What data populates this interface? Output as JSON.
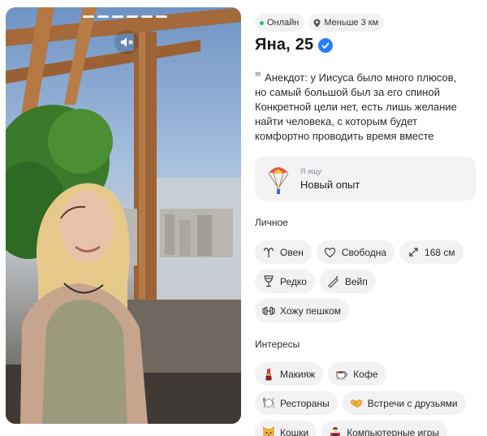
{
  "photo": {
    "progress_segments": 6,
    "mute_icon": "speaker-muted-icon"
  },
  "status": {
    "online_label": "Онлайн",
    "distance_label": "Меньше 3 км",
    "online_color": "#2cc44a"
  },
  "profile": {
    "name_age": "Яна, 25",
    "verified_color": "#2a7dff",
    "bio_lines": [
      "Анекдот: у Иисуса было много плюсов,",
      "но самый большой был за его спиной",
      "Конкретной цели нет, есть лишь желание",
      "найти человека, с которым будет",
      "комфортно проводить время вместе"
    ]
  },
  "seeking": {
    "label": "Я ищу",
    "value": "Новый опыт",
    "icon": "parachute-icon"
  },
  "personal": {
    "title": "Личное",
    "rows": [
      [
        {
          "icon": "aries-icon",
          "label": "Овен"
        },
        {
          "icon": "heart-icon",
          "label": "Свободна"
        },
        {
          "icon": "height-icon",
          "label": "168 см"
        }
      ],
      [
        {
          "icon": "wine-glass-icon",
          "label": "Редко"
        },
        {
          "icon": "vape-icon",
          "label": "Вейп"
        }
      ],
      [
        {
          "icon": "dumbbell-icon",
          "label": "Хожу пешком"
        }
      ]
    ]
  },
  "interests": {
    "title": "Интересы",
    "rows": [
      [
        {
          "icon": "lipstick-icon",
          "label": "Макияж"
        },
        {
          "icon": "coffee-icon",
          "label": "Кофе"
        }
      ],
      [
        {
          "icon": "restaurant-icon",
          "label": "Рестораны"
        },
        {
          "icon": "handshake-icon",
          "label": "Встречи с друзьями"
        }
      ],
      [
        {
          "icon": "cat-icon",
          "label": "Кошки"
        },
        {
          "icon": "gamer-icon",
          "label": "Компьютерные игры"
        }
      ]
    ]
  }
}
